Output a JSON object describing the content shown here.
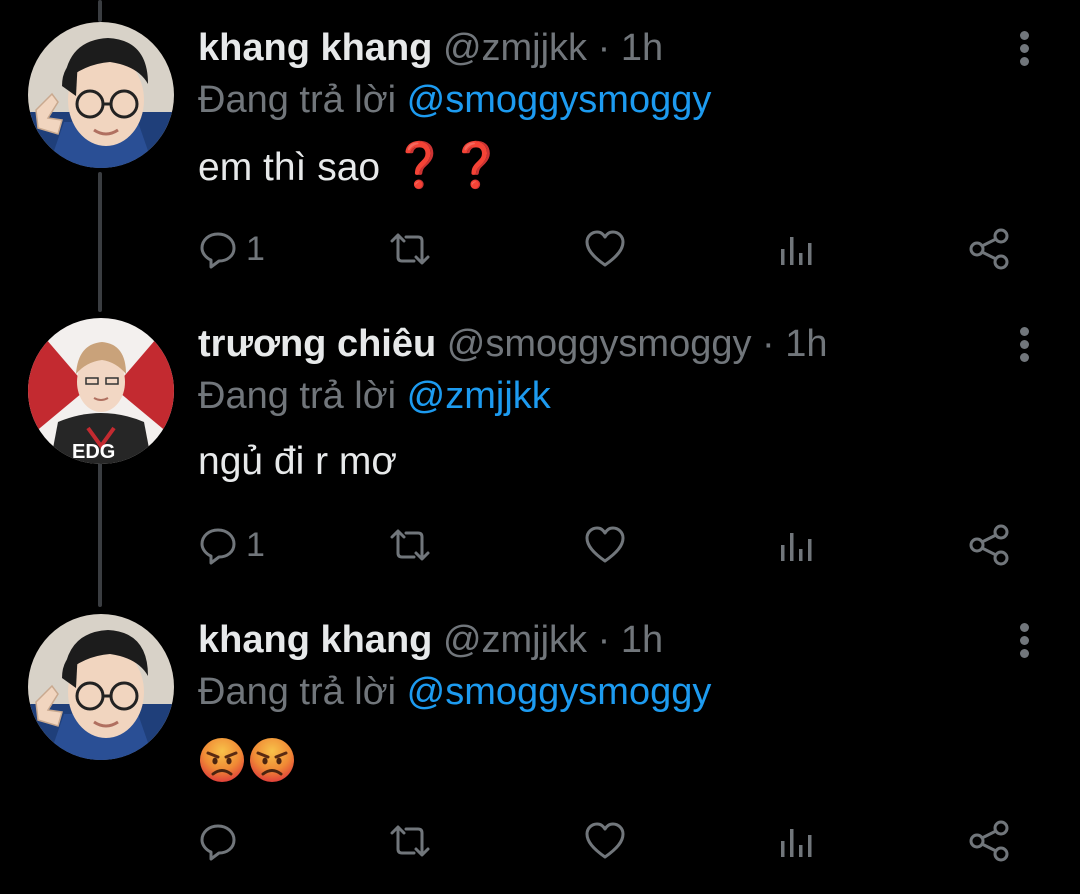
{
  "colors": {
    "background": "#000000",
    "primary_text": "#e7e9ea",
    "secondary_text": "#71767b",
    "link": "#1d9bf0",
    "thread_line": "#3a3d41"
  },
  "tweets": [
    {
      "display_name": "khang khang",
      "handle": "@zmjjkk",
      "separator": "·",
      "time": "1h",
      "replying_prefix": "Đang trả lời",
      "replying_to": "@smoggysmoggy",
      "text": "em thì sao",
      "emoji": "❓❓",
      "reply_count": "1",
      "retweet_count": "",
      "like_count": ""
    },
    {
      "display_name": "trương chiêu",
      "handle": "@smoggysmoggy",
      "separator": "·",
      "time": "1h",
      "replying_prefix": "Đang trả lời",
      "replying_to": "@zmjjkk",
      "text": "ngủ đi r mơ",
      "reply_count": "1",
      "retweet_count": "",
      "like_count": ""
    },
    {
      "display_name": "khang khang",
      "handle": "@zmjjkk",
      "separator": "·",
      "time": "1h",
      "replying_prefix": "Đang trả lời",
      "replying_to": "@smoggysmoggy",
      "text": "",
      "emoji_names": [
        "angry-face",
        "angry-face"
      ],
      "reply_count": "",
      "retweet_count": "",
      "like_count": ""
    }
  ],
  "icons": {
    "reply": "reply-icon",
    "retweet": "retweet-icon",
    "like": "heart-icon",
    "views": "views-icon",
    "share": "share-icon",
    "more": "more-vertical-icon"
  }
}
